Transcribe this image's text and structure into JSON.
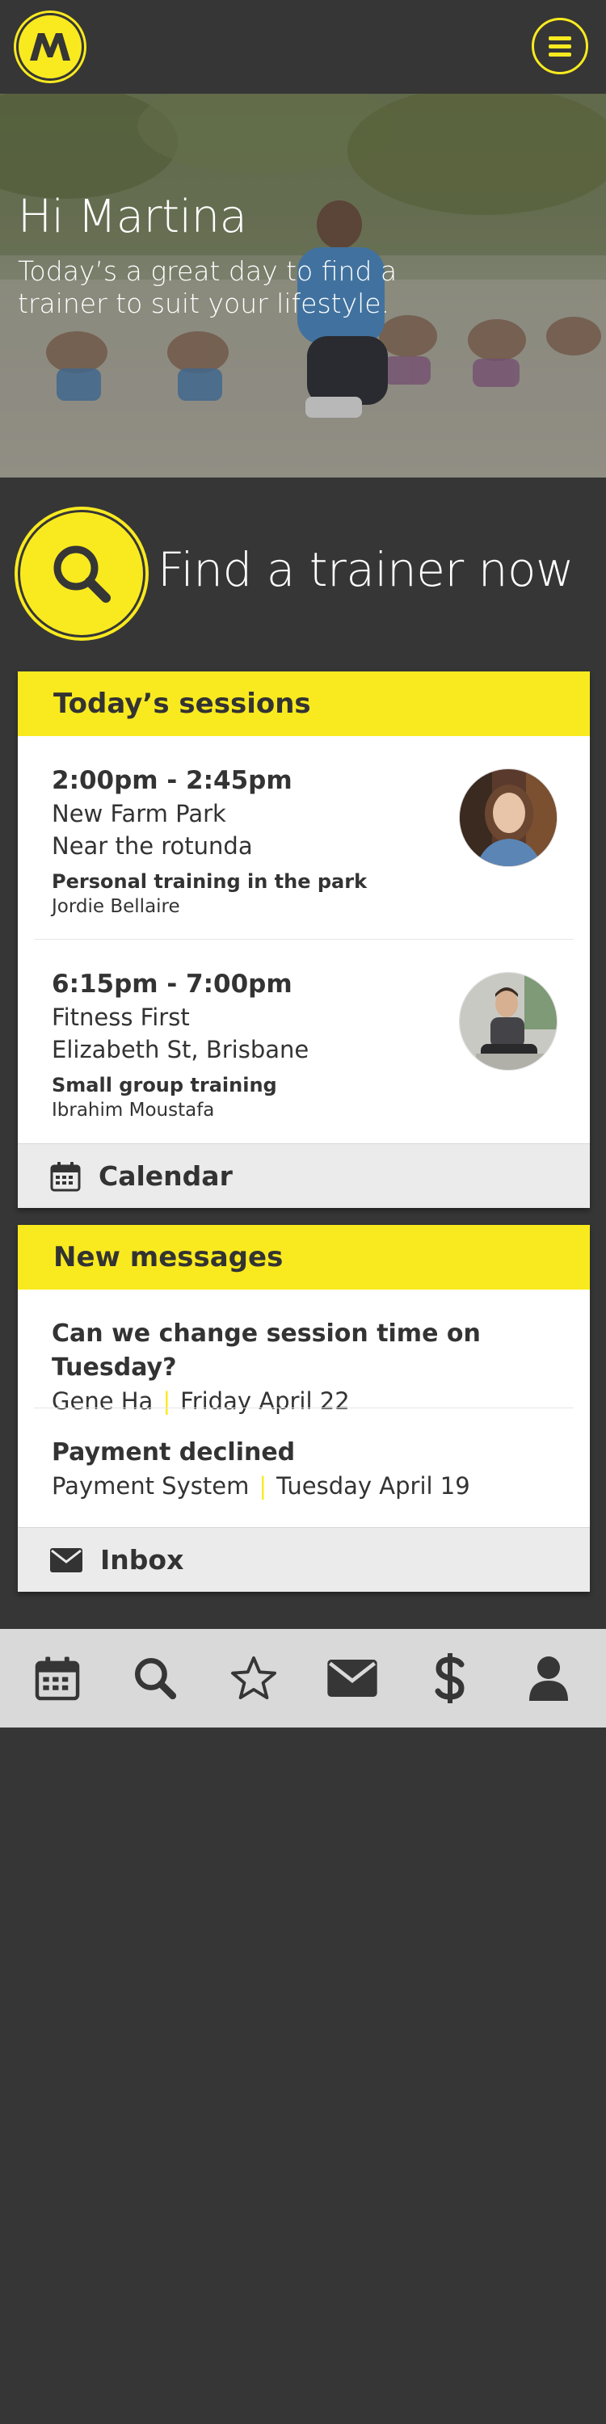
{
  "header": {
    "logo_letter": "M",
    "menu_icon": "hamburger-icon",
    "brand_color": "#f9ea1f",
    "background_color": "#363636"
  },
  "hero": {
    "greeting": "Hi Martina",
    "subtitle": "Today’s a great day to find a trainer to suit your lifestyle."
  },
  "find": {
    "label": "Find a trainer now",
    "icon": "search-icon"
  },
  "sessions": {
    "title": "Today’s sessions",
    "items": [
      {
        "time": "2:00pm - 2:45pm",
        "location": "New Farm Park",
        "detail": "Near the rotunda",
        "type": "Personal training in the park",
        "trainer": "Jordie Bellaire"
      },
      {
        "time": "6:15pm - 7:00pm",
        "location": "Fitness First",
        "detail": "Elizabeth St, Brisbane",
        "type": "Small group training",
        "trainer": "Ibrahim Moustafa"
      }
    ],
    "footer_label": "Calendar",
    "footer_icon": "calendar-icon"
  },
  "messages": {
    "title": "New messages",
    "items": [
      {
        "subject": "Can we change session time on Tuesday?",
        "sender": "Gene Ha",
        "date": "Friday April 22"
      },
      {
        "subject": "Payment declined",
        "sender": "Payment System",
        "date": "Tuesday April 19"
      }
    ],
    "footer_label": "Inbox",
    "footer_icon": "envelope-icon"
  },
  "bottom_nav": {
    "items": [
      "calendar-icon",
      "search-icon",
      "star-icon",
      "envelope-icon",
      "dollar-icon",
      "user-icon"
    ]
  }
}
